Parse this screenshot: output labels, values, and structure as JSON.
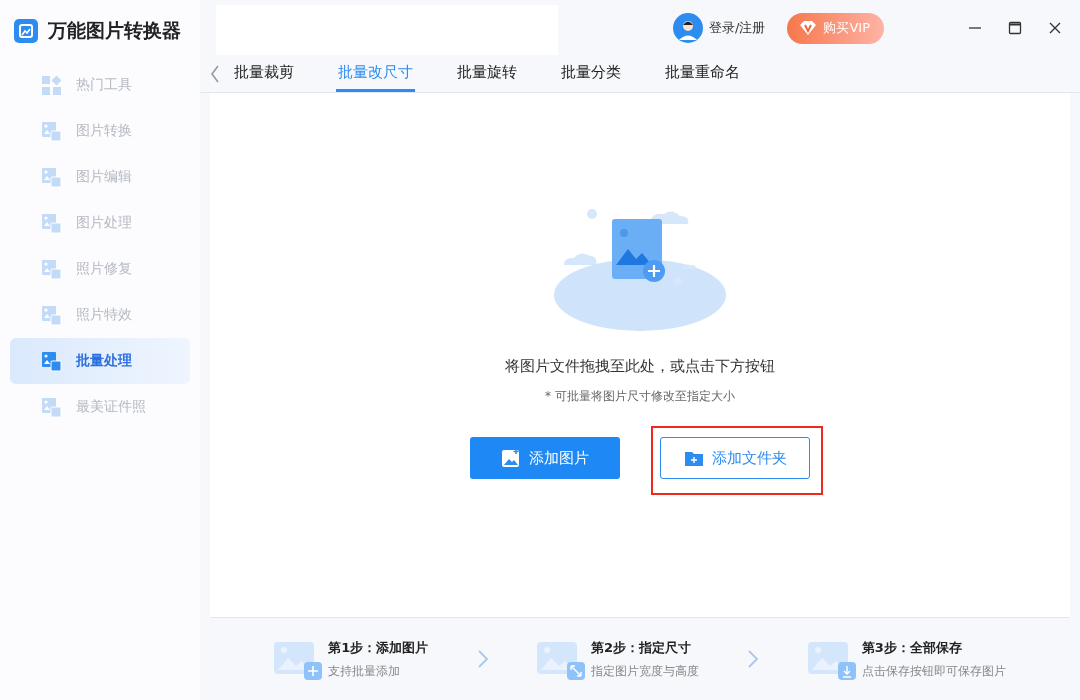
{
  "app": {
    "title": "万能图片转换器"
  },
  "header": {
    "login": "登录/注册",
    "vip": "购买VIP"
  },
  "sidebar": {
    "items": [
      {
        "label": "热门工具",
        "selected": false
      },
      {
        "label": "图片转换",
        "selected": false
      },
      {
        "label": "图片编辑",
        "selected": false
      },
      {
        "label": "图片处理",
        "selected": false
      },
      {
        "label": "照片修复",
        "selected": false
      },
      {
        "label": "照片特效",
        "selected": false
      },
      {
        "label": "批量处理",
        "selected": true
      },
      {
        "label": "最美证件照",
        "selected": false
      }
    ]
  },
  "tabs": [
    {
      "label": "批量裁剪",
      "selected": false
    },
    {
      "label": "批量改尺寸",
      "selected": true
    },
    {
      "label": "批量旋转",
      "selected": false
    },
    {
      "label": "批量分类",
      "selected": false
    },
    {
      "label": "批量重命名",
      "selected": false
    }
  ],
  "drop_zone": {
    "hint": "将图片文件拖拽至此处，或点击下方按钮",
    "note": "* 可批量将图片尺寸修改至指定大小",
    "buttons": [
      {
        "label": "添加图片",
        "kind": "primary",
        "highlighted": false
      },
      {
        "label": "添加文件夹",
        "kind": "outline",
        "highlighted": true
      }
    ]
  },
  "steps": [
    {
      "title": "第1步：添加图片",
      "subtitle": "支持批量添加"
    },
    {
      "title": "第2步：指定尺寸",
      "subtitle": "指定图片宽度与高度"
    },
    {
      "title": "第3步：全部保存",
      "subtitle": "点击保存按钮即可保存图片"
    }
  ]
}
